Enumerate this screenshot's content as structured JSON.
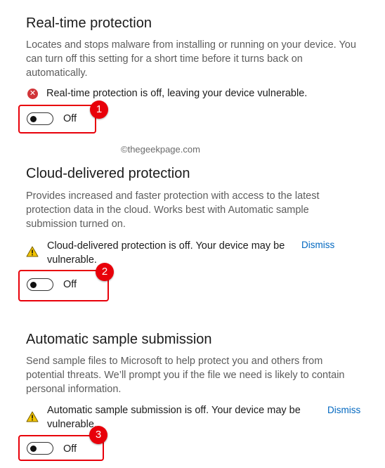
{
  "sections": [
    {
      "title": "Real-time protection",
      "description": [
        "Locates and stops malware from installing or running on your device. You",
        "can turn off this setting for a short time before it turns back on",
        "automatically."
      ],
      "status_icon": "error-icon",
      "status": [
        "Real-time protection is off, leaving your device vulnerable."
      ],
      "toggle_label": "Off",
      "toggle_on": false,
      "badge": "1"
    },
    {
      "title": "Cloud-delivered protection",
      "description": [
        "Provides increased and faster protection with access to the latest",
        "protection data in the cloud. Works best with Automatic sample",
        "submission turned on."
      ],
      "status_icon": "warning-icon",
      "status": [
        "Cloud-delivered protection is off. Your device may be",
        "vulnerable."
      ],
      "dismiss": "Dismiss",
      "toggle_label": "Off",
      "toggle_on": false,
      "badge": "2"
    },
    {
      "title": "Automatic sample submission",
      "description": [
        "Send sample files to Microsoft to help protect you and others from",
        "potential threats. We’ll prompt you if the file we need is likely to contain",
        "personal information."
      ],
      "status_icon": "warning-icon",
      "status": [
        "Automatic sample submission is off. Your device may be",
        "vulnerable."
      ],
      "dismiss": "Dismiss",
      "toggle_label": "Off",
      "toggle_on": false,
      "badge": "3"
    }
  ],
  "watermark": "©thegeekpage.com",
  "colors": {
    "error": "#d13438",
    "warning": "#f2c400",
    "link": "#0067c0",
    "highlight": "#e8000a"
  }
}
